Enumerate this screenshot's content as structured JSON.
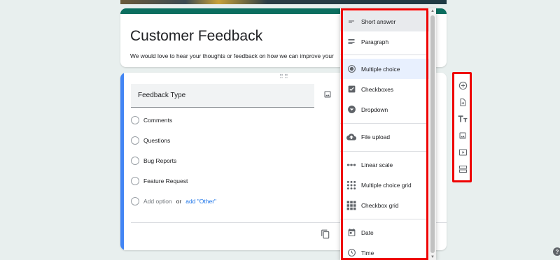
{
  "form": {
    "title": "Customer Feedback",
    "description": "We would love to hear your thoughts or feedback on how we can improve your"
  },
  "question": {
    "title": "Feedback Type",
    "options": [
      "Comments",
      "Questions",
      "Bug Reports",
      "Feature Request"
    ],
    "add_option": "Add option",
    "or": "or",
    "add_other": "add \"Other\""
  },
  "type_menu": {
    "items": [
      {
        "label": "Short answer",
        "icon": "short-answer-icon"
      },
      {
        "label": "Paragraph",
        "icon": "paragraph-icon"
      },
      {
        "label": "Multiple choice",
        "icon": "radio-button-icon"
      },
      {
        "label": "Checkboxes",
        "icon": "checkbox-icon"
      },
      {
        "label": "Dropdown",
        "icon": "dropdown-icon"
      },
      {
        "label": "File upload",
        "icon": "cloud-upload-icon"
      },
      {
        "label": "Linear scale",
        "icon": "linear-scale-icon"
      },
      {
        "label": "Multiple choice grid",
        "icon": "grid-icon"
      },
      {
        "label": "Checkbox grid",
        "icon": "checkbox-grid-icon"
      },
      {
        "label": "Date",
        "icon": "calendar-icon"
      },
      {
        "label": "Time",
        "icon": "clock-icon"
      }
    ],
    "selected": "Multiple choice",
    "hovered": "Short answer"
  },
  "toolbar": {
    "tools": [
      "add-question-icon",
      "import-questions-icon",
      "add-title-icon",
      "add-image-icon",
      "add-video-icon",
      "add-section-icon"
    ]
  },
  "help": "?",
  "colors": {
    "theme": "#0b6e5f",
    "accent": "#4285f4",
    "highlight": "#e00000",
    "link": "#1a73e8"
  }
}
